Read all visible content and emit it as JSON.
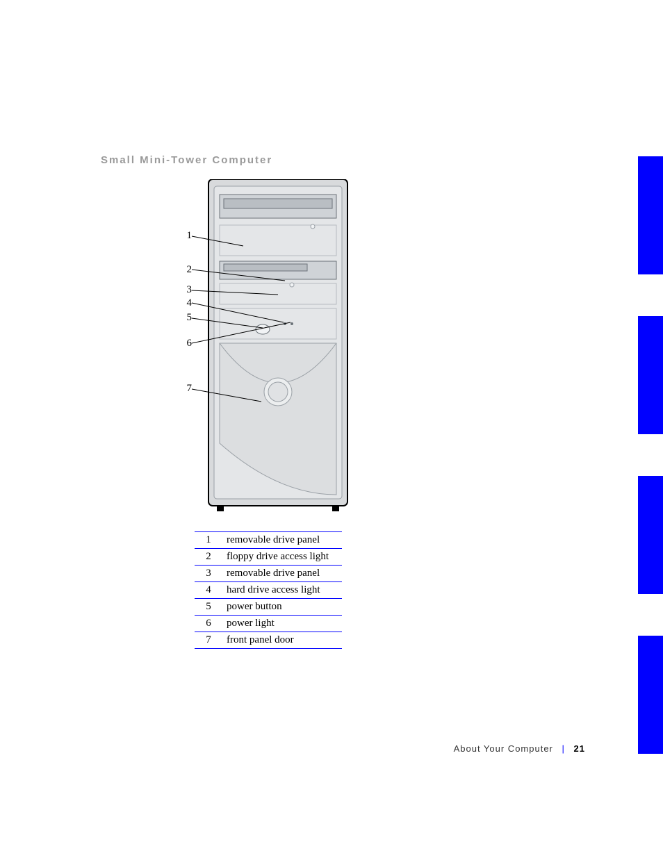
{
  "heading": "Small Mini-Tower Computer",
  "callouts": [
    "1",
    "2",
    "3",
    "4",
    "5",
    "6",
    "7"
  ],
  "legend": [
    {
      "n": "1",
      "label": "removable drive panel"
    },
    {
      "n": "2",
      "label": "floppy drive access light"
    },
    {
      "n": "3",
      "label": "removable drive panel"
    },
    {
      "n": "4",
      "label": "hard drive access light"
    },
    {
      "n": "5",
      "label": "power button"
    },
    {
      "n": "6",
      "label": "power light"
    },
    {
      "n": "7",
      "label": "front panel door"
    }
  ],
  "footer": {
    "section": "About Your Computer",
    "separator": "|",
    "page": "21"
  }
}
